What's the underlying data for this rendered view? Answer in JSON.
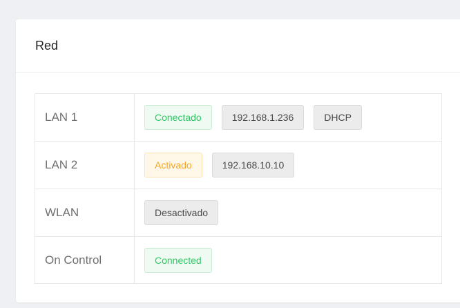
{
  "card": {
    "title": "Red"
  },
  "colors": {
    "success_text": "#2ec762",
    "warning_text": "#f5a623",
    "neutral_text": "#4a4a4a"
  },
  "rows": [
    {
      "label": "LAN 1",
      "badges": [
        {
          "text": "Conectado",
          "variant": "success"
        },
        {
          "text": "192.168.1.236",
          "variant": "neutral"
        },
        {
          "text": "DHCP",
          "variant": "neutral"
        }
      ]
    },
    {
      "label": "LAN 2",
      "badges": [
        {
          "text": "Activado",
          "variant": "warning"
        },
        {
          "text": "192.168.10.10",
          "variant": "neutral"
        }
      ]
    },
    {
      "label": "WLAN",
      "badges": [
        {
          "text": "Desactivado",
          "variant": "neutral"
        }
      ]
    },
    {
      "label": "On Control",
      "badges": [
        {
          "text": "Connected",
          "variant": "success"
        }
      ]
    }
  ]
}
